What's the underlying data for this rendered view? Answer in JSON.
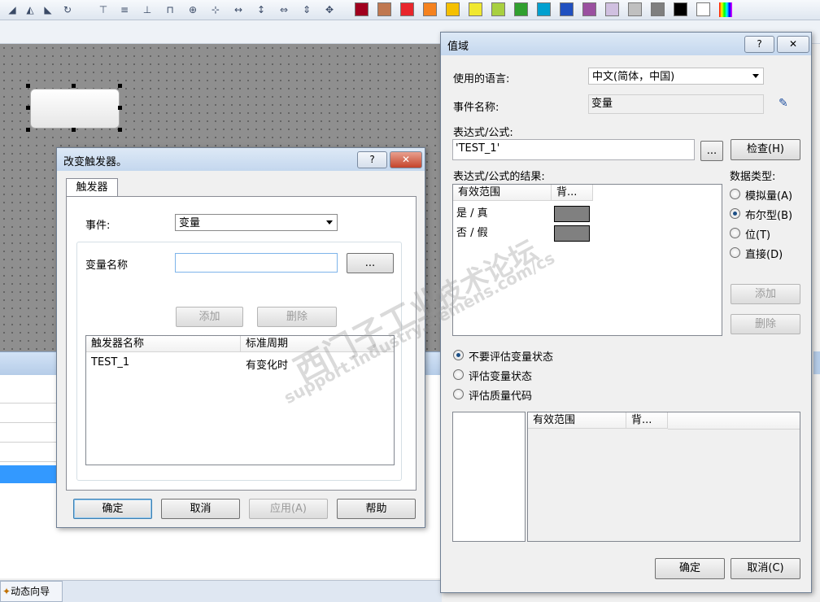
{
  "toolbar": {
    "colors": [
      "#a0001e",
      "#c07850",
      "#e8262c",
      "#f5821f",
      "#f5c000",
      "#f0e830",
      "#a8d040",
      "#30a030",
      "#00a0d0",
      "#2050c0",
      "#9a50a0",
      "#d0c0e0",
      "#c0c0c0",
      "#7f7f7f",
      "#000000",
      "#ffffff"
    ]
  },
  "status": {
    "dynamic_wizard_tab": "动态向导"
  },
  "trigger_dialog": {
    "title": "改变触发器。",
    "help_btn": "?",
    "close_btn": "✕",
    "tab": "触发器",
    "event_label": "事件:",
    "event_value": "变量",
    "var_name_label": "变量名称",
    "var_name_value": "",
    "browse_btn": "...",
    "add_btn": "添加",
    "delete_btn": "删除",
    "columns": [
      "触发器名称",
      "标准周期"
    ],
    "rows": [
      {
        "name": "TEST_1",
        "cycle": "有变化时"
      }
    ],
    "ok_btn": "确定",
    "cancel_btn": "取消",
    "apply_btn": "应用(A)",
    "help_text_btn": "帮助"
  },
  "value_dialog": {
    "title": "值域",
    "help_btn": "?",
    "close_btn": "✕",
    "language_label": "使用的语言:",
    "language_value": "中文(简体，中国)",
    "event_name_label": "事件名称:",
    "event_name_value": "变量",
    "expr_label": "表达式/公式:",
    "expr_value": "'TEST_1'",
    "expr_browse_btn": "...",
    "check_btn": "检查(H)",
    "result_label": "表达式/公式的结果:",
    "result_columns": [
      "有效范围",
      "背..."
    ],
    "result_rows": [
      {
        "range": "是 / 真",
        "color": "#808080"
      },
      {
        "range": "否 / 假",
        "color": "#808080"
      }
    ],
    "data_type_label": "数据类型:",
    "data_types": [
      {
        "label": "模拟量(A)",
        "selected": false
      },
      {
        "label": "布尔型(B)",
        "selected": true
      },
      {
        "label": "位(T)",
        "selected": false
      },
      {
        "label": "直接(D)",
        "selected": false
      }
    ],
    "add_btn": "添加",
    "delete_btn": "删除",
    "eval_options": [
      {
        "label": "不要评估变量状态",
        "selected": true
      },
      {
        "label": "评估变量状态",
        "selected": false
      },
      {
        "label": "评估质量代码",
        "selected": false
      }
    ],
    "lower_columns": [
      "有效范围",
      "背..."
    ],
    "ok_btn": "确定",
    "cancel_btn": "取消(C)"
  },
  "watermark": {
    "line1": "西门子工业",
    "line2": "support.industry.siemens.com/cs",
    "line3": "技术论坛"
  }
}
